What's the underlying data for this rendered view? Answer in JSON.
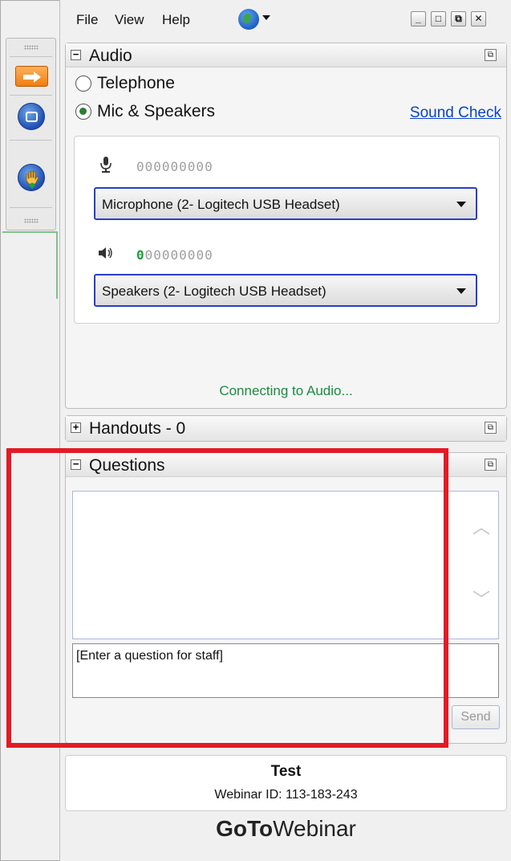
{
  "menu": {
    "file": "File",
    "view": "View",
    "help": "Help"
  },
  "window_controls": {
    "minimize": "_",
    "maximize": "□",
    "restore": "⧉",
    "close": "✕"
  },
  "audio": {
    "title": "Audio",
    "toggle": "−",
    "option_telephone": "Telephone",
    "option_mic": "Mic & Speakers",
    "selected": "Mic & Speakers",
    "sound_check": "Sound Check",
    "mic_meter": "000000000",
    "speaker_meter_active": "0",
    "speaker_meter_rest": "00000000",
    "microphone_device": "Microphone (2- Logitech USB Headset)",
    "speaker_device": "Speakers (2- Logitech USB Headset)",
    "status": "Connecting to Audio..."
  },
  "handouts": {
    "title": "Handouts - 0",
    "toggle": "+"
  },
  "questions": {
    "title": "Questions",
    "toggle": "−",
    "input_value": "[Enter a question for staff]",
    "send_label": "Send"
  },
  "webinar": {
    "title": "Test",
    "id_line": "Webinar ID: 113-183-243"
  },
  "brand": {
    "bold": "GoTo",
    "rest": "Webinar"
  },
  "colors": {
    "highlight": "#e21b25",
    "status_green": "#1b8a43",
    "link_blue": "#0b44c8",
    "select_border": "#2b3dc9"
  }
}
